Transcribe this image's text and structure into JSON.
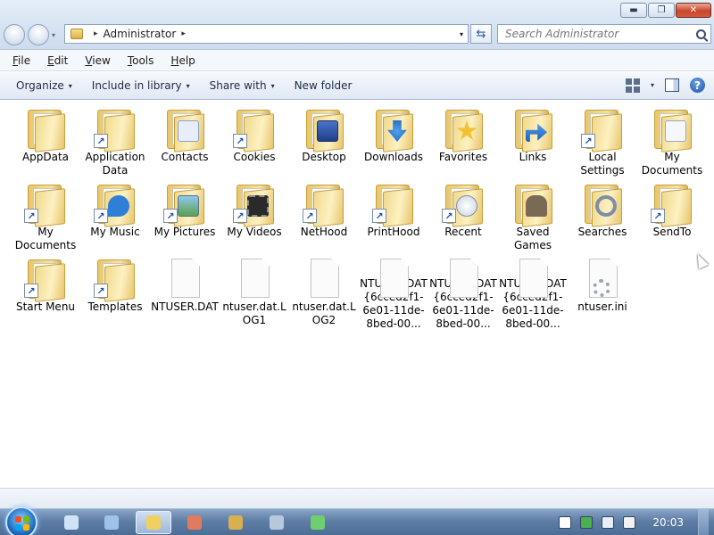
{
  "window": {
    "controls": {
      "minimize": "▬",
      "maximize": "❐",
      "close": "✕"
    }
  },
  "address": {
    "crumbs": [
      "Administrator"
    ],
    "separator": "▸",
    "dropdown": "▾",
    "refresh": "⇆"
  },
  "search": {
    "placeholder": "Search Administrator"
  },
  "menubar": {
    "items": [
      "File",
      "Edit",
      "View",
      "Tools",
      "Help"
    ]
  },
  "commandbar": {
    "items": [
      "Organize",
      "Include in library",
      "Share with",
      "New folder"
    ],
    "arrow": "▾",
    "help": "?"
  },
  "items": [
    {
      "label": "AppData",
      "kind": "folder",
      "shortcut": false,
      "overlay": ""
    },
    {
      "label": "Application Data",
      "kind": "folder",
      "shortcut": true,
      "overlay": ""
    },
    {
      "label": "Contacts",
      "kind": "folder",
      "shortcut": false,
      "overlay": "contact-card"
    },
    {
      "label": "Cookies",
      "kind": "folder",
      "shortcut": true,
      "overlay": ""
    },
    {
      "label": "Desktop",
      "kind": "folder",
      "shortcut": false,
      "overlay": "desktop-screen"
    },
    {
      "label": "Downloads",
      "kind": "folder",
      "shortcut": false,
      "overlay": "download-arrow"
    },
    {
      "label": "Favorites",
      "kind": "folder",
      "shortcut": false,
      "overlay": "star"
    },
    {
      "label": "Links",
      "kind": "folder",
      "shortcut": false,
      "overlay": "link-arrow"
    },
    {
      "label": "Local Settings",
      "kind": "folder",
      "shortcut": true,
      "overlay": ""
    },
    {
      "label": "My Documents",
      "kind": "folder",
      "shortcut": false,
      "overlay": "documents"
    },
    {
      "label": "My Documents",
      "kind": "folder",
      "shortcut": true,
      "overlay": ""
    },
    {
      "label": "My Music",
      "kind": "folder",
      "shortcut": true,
      "overlay": "music-note"
    },
    {
      "label": "My Pictures",
      "kind": "folder",
      "shortcut": true,
      "overlay": "picture"
    },
    {
      "label": "My Videos",
      "kind": "folder",
      "shortcut": true,
      "overlay": "film"
    },
    {
      "label": "NetHood",
      "kind": "folder",
      "shortcut": true,
      "overlay": ""
    },
    {
      "label": "PrintHood",
      "kind": "folder",
      "shortcut": true,
      "overlay": ""
    },
    {
      "label": "Recent",
      "kind": "folder",
      "shortcut": true,
      "overlay": "clock-docs"
    },
    {
      "label": "Saved Games",
      "kind": "folder",
      "shortcut": false,
      "overlay": "chess"
    },
    {
      "label": "Searches",
      "kind": "folder",
      "shortcut": false,
      "overlay": "magnifier"
    },
    {
      "label": "SendTo",
      "kind": "folder",
      "shortcut": true,
      "overlay": ""
    },
    {
      "label": "Start Menu",
      "kind": "folder",
      "shortcut": true,
      "overlay": ""
    },
    {
      "label": "Templates",
      "kind": "folder",
      "shortcut": true,
      "overlay": ""
    },
    {
      "label": "NTUSER.DAT",
      "kind": "file",
      "shortcut": false,
      "overlay": ""
    },
    {
      "label": "ntuser.dat.LOG1",
      "kind": "file",
      "shortcut": false,
      "overlay": ""
    },
    {
      "label": "ntuser.dat.LOG2",
      "kind": "file",
      "shortcut": false,
      "overlay": ""
    },
    {
      "label": "NTUSER.DAT{6cced2f1-6e01-11de-8bed-00...",
      "kind": "file",
      "shortcut": false,
      "overlay": ""
    },
    {
      "label": "NTUSER.DAT{6cced2f1-6e01-11de-8bed-00...",
      "kind": "file",
      "shortcut": false,
      "overlay": ""
    },
    {
      "label": "NTUSER.DAT{6cced2f1-6e01-11de-8bed-00...",
      "kind": "file",
      "shortcut": false,
      "overlay": ""
    },
    {
      "label": "ntuser.ini",
      "kind": "file-ini",
      "shortcut": false,
      "overlay": ""
    }
  ],
  "taskbar": {
    "clock": "20:03",
    "buttons": [
      {
        "name": "ie-taskbar-button",
        "color": "#cfe3f5",
        "active": false
      },
      {
        "name": "media-taskbar-button",
        "color": "#9fc3e8",
        "active": false
      },
      {
        "name": "explorer-taskbar-button",
        "color": "#f1cf62",
        "active": true
      },
      {
        "name": "paint-taskbar-button",
        "color": "#e07b5d",
        "active": false
      },
      {
        "name": "palette-taskbar-button",
        "color": "#d9b04f",
        "active": false
      },
      {
        "name": "calculator-taskbar-button",
        "color": "#b8c8dc",
        "active": false
      },
      {
        "name": "network-taskbar-button",
        "color": "#6fcf6f",
        "active": false
      }
    ],
    "tray": [
      {
        "name": "document-tray-icon",
        "color": "#ffffff"
      },
      {
        "name": "shield-tray-icon",
        "color": "#4caf50"
      },
      {
        "name": "network-tray-icon",
        "color": "#e8eef6"
      },
      {
        "name": "volume-muted-tray-icon",
        "color": "#f2f2f2"
      }
    ]
  },
  "colors": {
    "accent": "#4c6d96",
    "folder": "#f6e3a1"
  }
}
